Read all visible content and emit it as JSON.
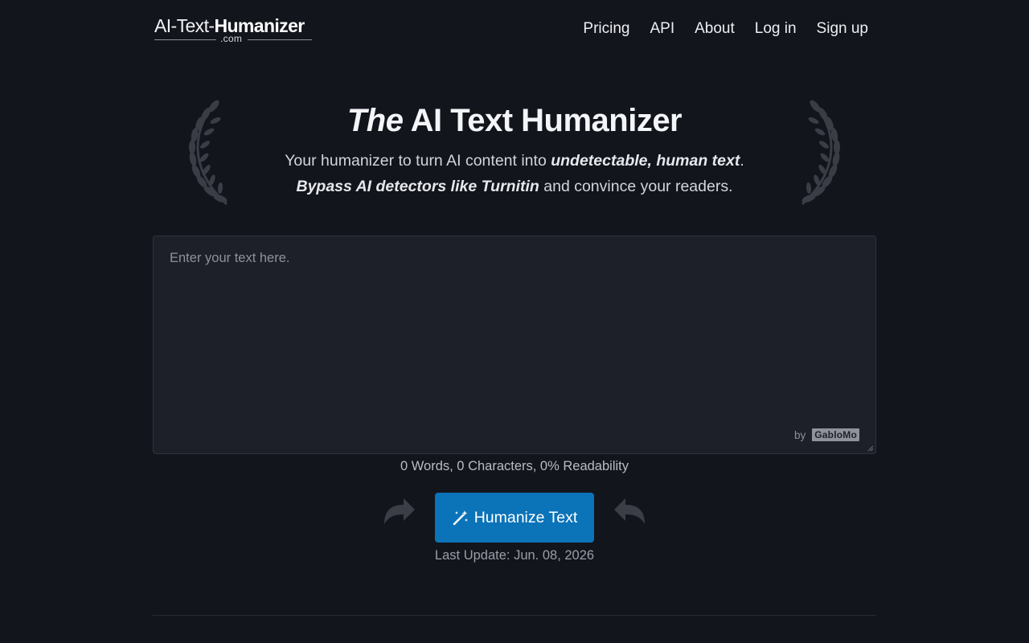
{
  "header": {
    "logo": {
      "part1": "AI-Text-",
      "part2": "Humanizer",
      "suffix": ".com"
    },
    "nav": [
      {
        "label": "Pricing"
      },
      {
        "label": "API"
      },
      {
        "label": "About"
      },
      {
        "label": "Log in"
      },
      {
        "label": "Sign up"
      }
    ]
  },
  "hero": {
    "title_em": "The",
    "title_rest": " AI Text Humanizer",
    "sub_line1_a": "Your humanizer to turn AI content into ",
    "sub_line1_b": "undetectable, human text",
    "sub_line1_c": ".",
    "sub_line2_a": "Bypass AI detectors like Turnitin",
    "sub_line2_b": " and convince your readers."
  },
  "editor": {
    "placeholder": "Enter your text here.",
    "value": "",
    "by_label": "by",
    "brand": "GabloMo"
  },
  "stats": {
    "text": "0 Words, 0 Characters, 0% Readability"
  },
  "cta": {
    "label": "Humanize Text"
  },
  "last_update": {
    "text": "Last Update: Jun. 08, 2026"
  },
  "colors": {
    "background": "#13151d",
    "editor_bg": "#1d2029",
    "accent": "#0b73b8"
  },
  "icons": {
    "laurel": "laurel-wreath-icon",
    "magic": "magic-wand-icon",
    "arrow_left": "curved-arrow-right-icon",
    "arrow_right": "curved-arrow-left-icon"
  }
}
